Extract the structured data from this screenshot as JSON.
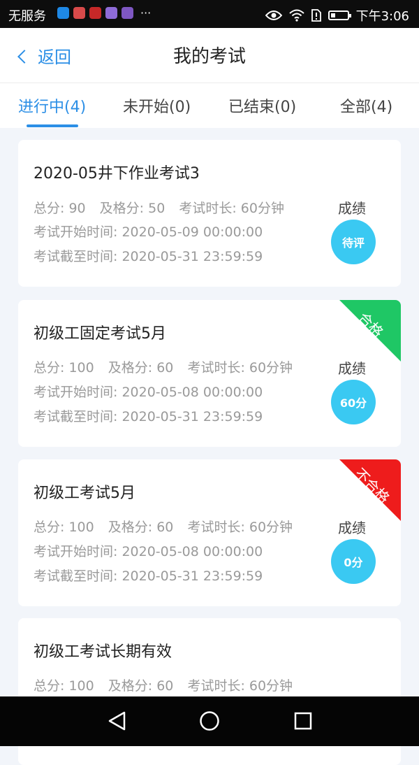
{
  "status_bar": {
    "carrier": "无服务",
    "more": "···",
    "time": "下午3:06",
    "app_icons": [
      {
        "name": "video-app-icon",
        "color": "#1e88e5"
      },
      {
        "name": "app-red-icon",
        "color": "#d84a4a"
      },
      {
        "name": "huawei-app-icon",
        "color": "#c62828"
      },
      {
        "name": "browser-app-icon",
        "color": "#8e6bd8"
      },
      {
        "name": "music-app-icon",
        "color": "#7e57c2"
      }
    ]
  },
  "header": {
    "back_label": "返回",
    "title": "我的考试"
  },
  "tabs": [
    {
      "label": "进行中(4)",
      "active": true
    },
    {
      "label": "未开始(0)",
      "active": false
    },
    {
      "label": "已结束(0)",
      "active": false
    },
    {
      "label": "全部(4)",
      "active": false
    }
  ],
  "exams": [
    {
      "title": "2020-05井下作业考试3",
      "total": "总分: 90",
      "pass": "及格分: 50",
      "duration": "考试时长: 60分钟",
      "start": "考试开始时间: 2020-05-09 00:00:00",
      "end": "考试截至时间: 2020-05-31 23:59:59",
      "grade_label": "成绩",
      "grade": "待评",
      "ribbon": null
    },
    {
      "title": "初级工固定考试5月",
      "total": "总分: 100",
      "pass": "及格分: 60",
      "duration": "考试时长: 60分钟",
      "start": "考试开始时间: 2020-05-08 00:00:00",
      "end": "考试截至时间: 2020-05-31 23:59:59",
      "grade_label": "成绩",
      "grade": "60分",
      "ribbon": {
        "text": "合格",
        "color": "#1fc765"
      }
    },
    {
      "title": "初级工考试5月",
      "total": "总分: 100",
      "pass": "及格分: 60",
      "duration": "考试时长: 60分钟",
      "start": "考试开始时间: 2020-05-08 00:00:00",
      "end": "考试截至时间: 2020-05-31 23:59:59",
      "grade_label": "成绩",
      "grade": "0分",
      "ribbon": {
        "text": "不合格",
        "color": "#ee1c1c"
      }
    },
    {
      "title": "初级工考试长期有效",
      "total": "总分: 100",
      "pass": "及格分: 60",
      "duration": "考试时长: 60分钟"
    }
  ],
  "colors": {
    "accent": "#2c8fe6",
    "grade_circle": "#3ac9f2",
    "pass": "#1fc765",
    "fail": "#ee1c1c"
  },
  "nav": {
    "back_icon": "triangle-back-icon",
    "home_icon": "circle-home-icon",
    "recent_icon": "square-recent-icon"
  }
}
